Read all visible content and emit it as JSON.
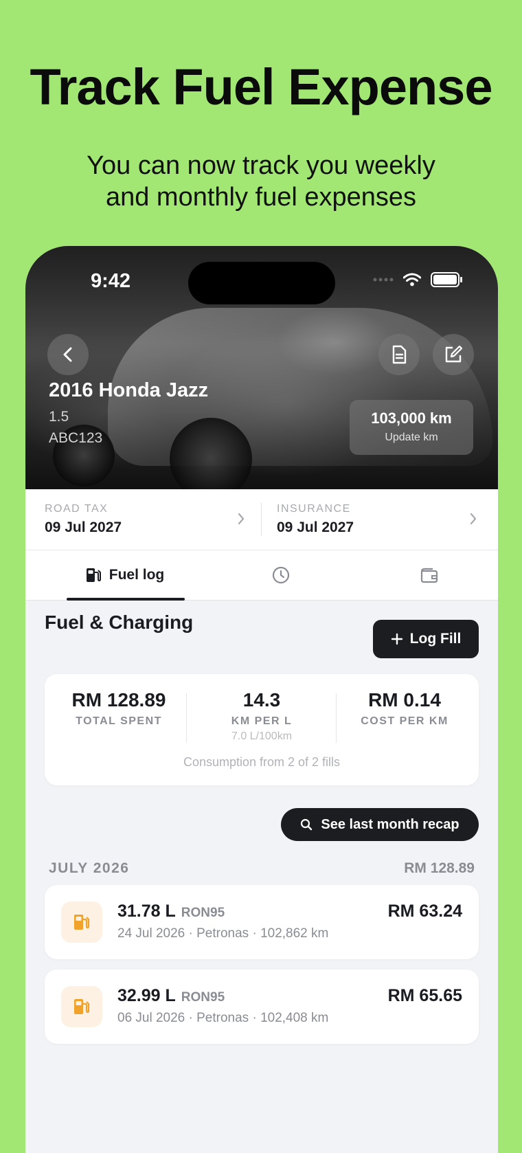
{
  "theme": {
    "background": "#a2e773",
    "accent_dark": "#1c1d21",
    "fuel_icon_color": "#f0a22a"
  },
  "promo": {
    "headline": "Track Fuel Expense",
    "subline_1": "You can now track you weekly",
    "subline_2": "and monthly fuel expenses"
  },
  "status_bar": {
    "time": "9:42",
    "icons": [
      "signal-dots-icon",
      "wifi-icon",
      "battery-icon"
    ]
  },
  "vehicle": {
    "name": "2016 Honda Jazz",
    "engine": "1.5",
    "plate": "ABC123",
    "odometer": "103,000 km",
    "odometer_action": "Update km"
  },
  "renewals": [
    {
      "label": "ROAD TAX",
      "date": "09 Jul 2027"
    },
    {
      "label": "INSURANCE",
      "date": "09 Jul 2027"
    }
  ],
  "tabs": [
    {
      "label": "Fuel log",
      "icon": "fuel-pump-icon",
      "active": true
    },
    {
      "label": "",
      "icon": "clock-icon",
      "active": false
    },
    {
      "label": "",
      "icon": "wallet-icon",
      "active": false
    }
  ],
  "section": {
    "title": "Fuel & Charging",
    "log_button": "Log Fill"
  },
  "stats": {
    "total_spent": {
      "value": "RM 128.89",
      "label": "TOTAL SPENT"
    },
    "km_per_l": {
      "value": "14.3",
      "label": "KM PER L",
      "sub": "7.0 L/100km"
    },
    "cost_per_km": {
      "value": "RM 0.14",
      "label": "COST PER KM"
    },
    "consumption_note": "Consumption from 2 of 2 fills"
  },
  "recap_button": "See last month recap",
  "month": {
    "label": "JULY 2026",
    "total": "RM 128.89"
  },
  "fills": [
    {
      "litres": "31.78 L",
      "grade": "RON95",
      "meta": "24 Jul 2026 · Petronas · 102,862 km",
      "amount": "RM 63.24"
    },
    {
      "litres": "32.99 L",
      "grade": "RON95",
      "meta": "06 Jul 2026 · Petronas · 102,408 km",
      "amount": "RM 65.65"
    }
  ]
}
